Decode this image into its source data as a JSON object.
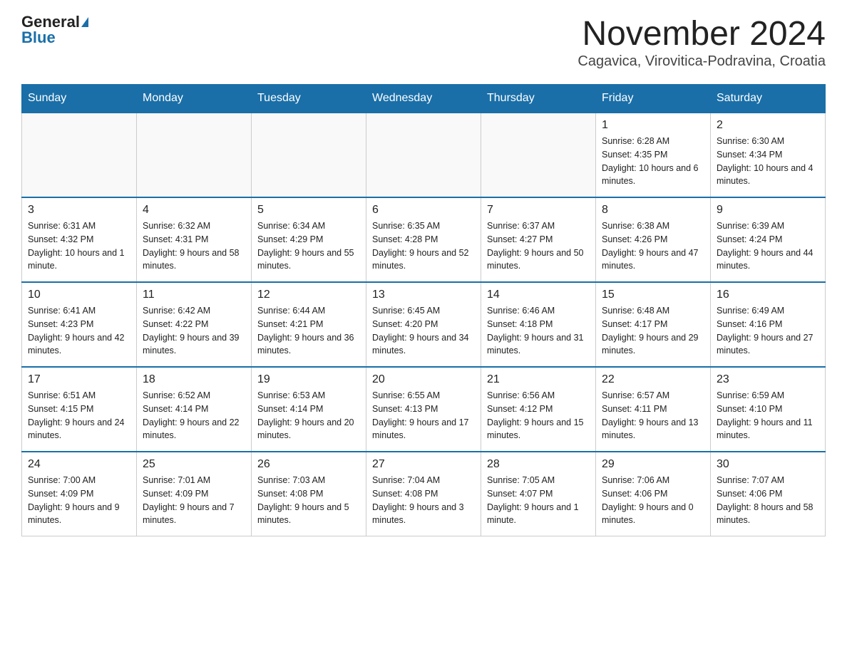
{
  "header": {
    "logo_general": "General",
    "logo_blue": "Blue",
    "month_title": "November 2024",
    "location": "Cagavica, Virovitica-Podravina, Croatia"
  },
  "weekdays": [
    "Sunday",
    "Monday",
    "Tuesday",
    "Wednesday",
    "Thursday",
    "Friday",
    "Saturday"
  ],
  "weeks": [
    {
      "days": [
        {
          "number": "",
          "sunrise": "",
          "sunset": "",
          "daylight": ""
        },
        {
          "number": "",
          "sunrise": "",
          "sunset": "",
          "daylight": ""
        },
        {
          "number": "",
          "sunrise": "",
          "sunset": "",
          "daylight": ""
        },
        {
          "number": "",
          "sunrise": "",
          "sunset": "",
          "daylight": ""
        },
        {
          "number": "",
          "sunrise": "",
          "sunset": "",
          "daylight": ""
        },
        {
          "number": "1",
          "sunrise": "Sunrise: 6:28 AM",
          "sunset": "Sunset: 4:35 PM",
          "daylight": "Daylight: 10 hours and 6 minutes."
        },
        {
          "number": "2",
          "sunrise": "Sunrise: 6:30 AM",
          "sunset": "Sunset: 4:34 PM",
          "daylight": "Daylight: 10 hours and 4 minutes."
        }
      ]
    },
    {
      "days": [
        {
          "number": "3",
          "sunrise": "Sunrise: 6:31 AM",
          "sunset": "Sunset: 4:32 PM",
          "daylight": "Daylight: 10 hours and 1 minute."
        },
        {
          "number": "4",
          "sunrise": "Sunrise: 6:32 AM",
          "sunset": "Sunset: 4:31 PM",
          "daylight": "Daylight: 9 hours and 58 minutes."
        },
        {
          "number": "5",
          "sunrise": "Sunrise: 6:34 AM",
          "sunset": "Sunset: 4:29 PM",
          "daylight": "Daylight: 9 hours and 55 minutes."
        },
        {
          "number": "6",
          "sunrise": "Sunrise: 6:35 AM",
          "sunset": "Sunset: 4:28 PM",
          "daylight": "Daylight: 9 hours and 52 minutes."
        },
        {
          "number": "7",
          "sunrise": "Sunrise: 6:37 AM",
          "sunset": "Sunset: 4:27 PM",
          "daylight": "Daylight: 9 hours and 50 minutes."
        },
        {
          "number": "8",
          "sunrise": "Sunrise: 6:38 AM",
          "sunset": "Sunset: 4:26 PM",
          "daylight": "Daylight: 9 hours and 47 minutes."
        },
        {
          "number": "9",
          "sunrise": "Sunrise: 6:39 AM",
          "sunset": "Sunset: 4:24 PM",
          "daylight": "Daylight: 9 hours and 44 minutes."
        }
      ]
    },
    {
      "days": [
        {
          "number": "10",
          "sunrise": "Sunrise: 6:41 AM",
          "sunset": "Sunset: 4:23 PM",
          "daylight": "Daylight: 9 hours and 42 minutes."
        },
        {
          "number": "11",
          "sunrise": "Sunrise: 6:42 AM",
          "sunset": "Sunset: 4:22 PM",
          "daylight": "Daylight: 9 hours and 39 minutes."
        },
        {
          "number": "12",
          "sunrise": "Sunrise: 6:44 AM",
          "sunset": "Sunset: 4:21 PM",
          "daylight": "Daylight: 9 hours and 36 minutes."
        },
        {
          "number": "13",
          "sunrise": "Sunrise: 6:45 AM",
          "sunset": "Sunset: 4:20 PM",
          "daylight": "Daylight: 9 hours and 34 minutes."
        },
        {
          "number": "14",
          "sunrise": "Sunrise: 6:46 AM",
          "sunset": "Sunset: 4:18 PM",
          "daylight": "Daylight: 9 hours and 31 minutes."
        },
        {
          "number": "15",
          "sunrise": "Sunrise: 6:48 AM",
          "sunset": "Sunset: 4:17 PM",
          "daylight": "Daylight: 9 hours and 29 minutes."
        },
        {
          "number": "16",
          "sunrise": "Sunrise: 6:49 AM",
          "sunset": "Sunset: 4:16 PM",
          "daylight": "Daylight: 9 hours and 27 minutes."
        }
      ]
    },
    {
      "days": [
        {
          "number": "17",
          "sunrise": "Sunrise: 6:51 AM",
          "sunset": "Sunset: 4:15 PM",
          "daylight": "Daylight: 9 hours and 24 minutes."
        },
        {
          "number": "18",
          "sunrise": "Sunrise: 6:52 AM",
          "sunset": "Sunset: 4:14 PM",
          "daylight": "Daylight: 9 hours and 22 minutes."
        },
        {
          "number": "19",
          "sunrise": "Sunrise: 6:53 AM",
          "sunset": "Sunset: 4:14 PM",
          "daylight": "Daylight: 9 hours and 20 minutes."
        },
        {
          "number": "20",
          "sunrise": "Sunrise: 6:55 AM",
          "sunset": "Sunset: 4:13 PM",
          "daylight": "Daylight: 9 hours and 17 minutes."
        },
        {
          "number": "21",
          "sunrise": "Sunrise: 6:56 AM",
          "sunset": "Sunset: 4:12 PM",
          "daylight": "Daylight: 9 hours and 15 minutes."
        },
        {
          "number": "22",
          "sunrise": "Sunrise: 6:57 AM",
          "sunset": "Sunset: 4:11 PM",
          "daylight": "Daylight: 9 hours and 13 minutes."
        },
        {
          "number": "23",
          "sunrise": "Sunrise: 6:59 AM",
          "sunset": "Sunset: 4:10 PM",
          "daylight": "Daylight: 9 hours and 11 minutes."
        }
      ]
    },
    {
      "days": [
        {
          "number": "24",
          "sunrise": "Sunrise: 7:00 AM",
          "sunset": "Sunset: 4:09 PM",
          "daylight": "Daylight: 9 hours and 9 minutes."
        },
        {
          "number": "25",
          "sunrise": "Sunrise: 7:01 AM",
          "sunset": "Sunset: 4:09 PM",
          "daylight": "Daylight: 9 hours and 7 minutes."
        },
        {
          "number": "26",
          "sunrise": "Sunrise: 7:03 AM",
          "sunset": "Sunset: 4:08 PM",
          "daylight": "Daylight: 9 hours and 5 minutes."
        },
        {
          "number": "27",
          "sunrise": "Sunrise: 7:04 AM",
          "sunset": "Sunset: 4:08 PM",
          "daylight": "Daylight: 9 hours and 3 minutes."
        },
        {
          "number": "28",
          "sunrise": "Sunrise: 7:05 AM",
          "sunset": "Sunset: 4:07 PM",
          "daylight": "Daylight: 9 hours and 1 minute."
        },
        {
          "number": "29",
          "sunrise": "Sunrise: 7:06 AM",
          "sunset": "Sunset: 4:06 PM",
          "daylight": "Daylight: 9 hours and 0 minutes."
        },
        {
          "number": "30",
          "sunrise": "Sunrise: 7:07 AM",
          "sunset": "Sunset: 4:06 PM",
          "daylight": "Daylight: 8 hours and 58 minutes."
        }
      ]
    }
  ]
}
